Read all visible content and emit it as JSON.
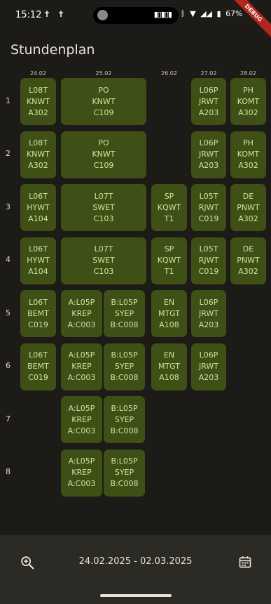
{
  "status": {
    "time": "15:12",
    "battery": "67%",
    "notif_icons": [
      "notification-icon",
      "notification-icon"
    ],
    "icons": [
      "bluetooth-icon",
      "wifi-icon",
      "signal-icon",
      "battery-icon"
    ]
  },
  "debug_label": "DEBUG",
  "title": "Stundenplan",
  "colors": {
    "background": "#1c1b17",
    "cell": "#3f5017",
    "cell_text": "#cfe39c",
    "bottom_bar": "#2b2a24",
    "debug": "#b3261e"
  },
  "dates": [
    "24.02",
    "25.02",
    "26.02",
    "27.02",
    "28.02"
  ],
  "hours": [
    "1",
    "2",
    "3",
    "4",
    "5",
    "6",
    "7",
    "8"
  ],
  "lessons": [
    {
      "day": 0,
      "hour": 1,
      "lines": [
        "L08T",
        "KNWT",
        "A302"
      ]
    },
    {
      "day": 1,
      "hour": 1,
      "lines": [
        "PO",
        "KNWT",
        "C109"
      ],
      "span": 2
    },
    {
      "day": 3,
      "hour": 1,
      "lines": [
        "L06P",
        "JRWT",
        "A203"
      ]
    },
    {
      "day": 4,
      "hour": 1,
      "lines": [
        "PH",
        "KOMT",
        "A302"
      ]
    },
    {
      "day": 0,
      "hour": 2,
      "lines": [
        "L08T",
        "KNWT",
        "A302"
      ]
    },
    {
      "day": 1,
      "hour": 2,
      "lines": [
        "PO",
        "KNWT",
        "C109"
      ],
      "span": 2
    },
    {
      "day": 3,
      "hour": 2,
      "lines": [
        "L06P",
        "JRWT",
        "A203"
      ]
    },
    {
      "day": 4,
      "hour": 2,
      "lines": [
        "PH",
        "KOMT",
        "A302"
      ]
    },
    {
      "day": 0,
      "hour": 3,
      "lines": [
        "L06T",
        "HYWT",
        "A104"
      ]
    },
    {
      "day": 1,
      "hour": 3,
      "lines": [
        "L07T",
        "SWET",
        "C103"
      ],
      "span": 2
    },
    {
      "day": 2,
      "hour": 3,
      "lines": [
        "SP",
        "KQWT",
        "T1"
      ]
    },
    {
      "day": 3,
      "hour": 3,
      "lines": [
        "L05T",
        "RJWT",
        "C019"
      ]
    },
    {
      "day": 4,
      "hour": 3,
      "lines": [
        "DE",
        "PNWT",
        "A302"
      ]
    },
    {
      "day": 0,
      "hour": 4,
      "lines": [
        "L06T",
        "HYWT",
        "A104"
      ]
    },
    {
      "day": 1,
      "hour": 4,
      "lines": [
        "L07T",
        "SWET",
        "C103"
      ],
      "span": 2
    },
    {
      "day": 2,
      "hour": 4,
      "lines": [
        "SP",
        "KQWT",
        "T1"
      ]
    },
    {
      "day": 3,
      "hour": 4,
      "lines": [
        "L05T",
        "RJWT",
        "C019"
      ]
    },
    {
      "day": 4,
      "hour": 4,
      "lines": [
        "DE",
        "PNWT",
        "A302"
      ]
    },
    {
      "day": 0,
      "hour": 5,
      "lines": [
        "L06T",
        "BEMT",
        "C019"
      ]
    },
    {
      "day": 1,
      "hour": 5,
      "lines": [
        "A:L05P",
        "KREP",
        "A:C003"
      ],
      "sub": 0
    },
    {
      "day": 1,
      "hour": 5,
      "lines": [
        "B:L05P",
        "SYEP",
        "B:C008"
      ],
      "sub": 1
    },
    {
      "day": 2,
      "hour": 5,
      "lines": [
        "EN",
        "MTGT",
        "A108"
      ]
    },
    {
      "day": 3,
      "hour": 5,
      "lines": [
        "L06P",
        "JRWT",
        "A203"
      ]
    },
    {
      "day": 0,
      "hour": 6,
      "lines": [
        "L06T",
        "BEMT",
        "C019"
      ]
    },
    {
      "day": 1,
      "hour": 6,
      "lines": [
        "A:L05P",
        "KREP",
        "A:C003"
      ],
      "sub": 0
    },
    {
      "day": 1,
      "hour": 6,
      "lines": [
        "B:L05P",
        "SYEP",
        "B:C008"
      ],
      "sub": 1
    },
    {
      "day": 2,
      "hour": 6,
      "lines": [
        "EN",
        "MTGT",
        "A108"
      ]
    },
    {
      "day": 3,
      "hour": 6,
      "lines": [
        "L06P",
        "JRWT",
        "A203"
      ]
    },
    {
      "day": 1,
      "hour": 7,
      "lines": [
        "A:L05P",
        "KREP",
        "A:C003"
      ],
      "sub": 0
    },
    {
      "day": 1,
      "hour": 7,
      "lines": [
        "B:L05P",
        "SYEP",
        "B:C008"
      ],
      "sub": 1
    },
    {
      "day": 1,
      "hour": 8,
      "lines": [
        "A:L05P",
        "KREP",
        "A:C003"
      ],
      "sub": 0
    },
    {
      "day": 1,
      "hour": 8,
      "lines": [
        "B:L05P",
        "SYEP",
        "B:C008"
      ],
      "sub": 1
    }
  ],
  "bottom": {
    "date_range": "24.02.2025 - 02.03.2025",
    "zoom_icon": "zoom-in-icon",
    "calendar_icon": "calendar-icon"
  }
}
